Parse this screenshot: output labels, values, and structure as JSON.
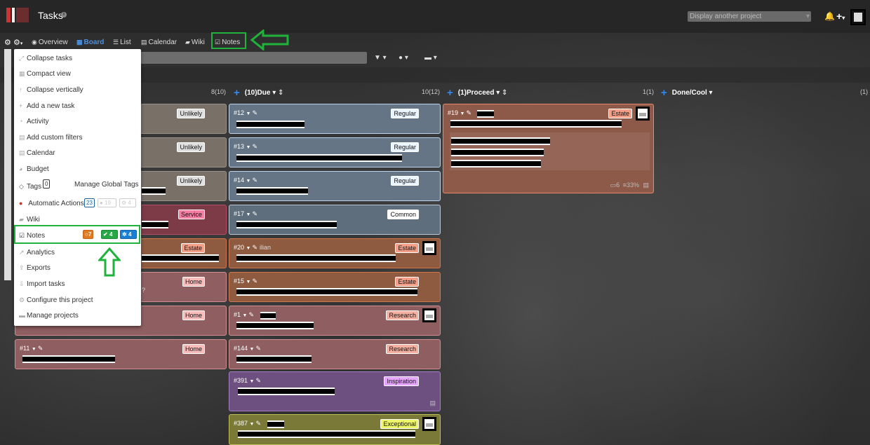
{
  "header": {
    "title": "Tasks",
    "info_icon": "info-icon",
    "project_select_placeholder": "Display another project",
    "bell_icon": "bell-icon",
    "plus_icon": "plus-icon"
  },
  "nav": {
    "settings_icon": "gear-icon",
    "items": [
      {
        "label": "Overview",
        "icon": "eye-icon"
      },
      {
        "label": "Board",
        "icon": "grid-icon",
        "active": true
      },
      {
        "label": "List",
        "icon": "list-icon"
      },
      {
        "label": "Calendar",
        "icon": "calendar-icon"
      },
      {
        "label": "Wiki",
        "icon": "book-icon"
      },
      {
        "label": "Notes",
        "icon": "checkbox-icon"
      }
    ]
  },
  "columns": [
    {
      "name": "(10)Due",
      "count": "8(10)"
    },
    {
      "name": "(1)Proceed",
      "count": "10(12)"
    },
    {
      "name": "Done/Cool",
      "count": "1(1)"
    },
    {
      "name": "",
      "count": "(1)"
    }
  ],
  "column1_cards": [
    {
      "tag": "Unlikely"
    },
    {
      "tag": "Unlikely"
    },
    {
      "tag": "Unlikely"
    },
    {
      "tag": "Service"
    },
    {
      "tag": "Estate"
    },
    {
      "tag": "Home"
    },
    {
      "tag": "Home"
    },
    {
      "id": "#11",
      "tag": "Home"
    }
  ],
  "column2_cards": [
    {
      "id": "#12",
      "tag": "Regular"
    },
    {
      "id": "#13",
      "tag": "Regular"
    },
    {
      "id": "#14",
      "tag": "Regular"
    },
    {
      "id": "#17",
      "tag": "Common"
    },
    {
      "id": "#20",
      "tag": "Estate",
      "assignee": "ilian"
    },
    {
      "id": "#15",
      "tag": "Estate"
    },
    {
      "id": "#1",
      "tag": "Research"
    },
    {
      "id": "#144",
      "tag": "Research"
    },
    {
      "id": "#391",
      "tag": "Inspiration"
    },
    {
      "id": "#387",
      "tag": "Exceptional"
    }
  ],
  "column3_cards": [
    {
      "id": "#19",
      "tag": "Estate",
      "footer_comments": "6",
      "footer_progress": "33%"
    }
  ],
  "menu": {
    "items": [
      {
        "label": "Collapse tasks",
        "icon": "collapse-icon"
      },
      {
        "label": "Compact view",
        "icon": "compact-icon"
      },
      {
        "label": "Collapse vertically",
        "icon": "arrow-up-icon"
      },
      {
        "label": "Add a new task",
        "icon": "plus-icon"
      },
      {
        "label": "Activity",
        "icon": "dashboard-icon"
      },
      {
        "label": "Add custom filters",
        "icon": "filter-icon"
      },
      {
        "label": "Calendar",
        "icon": "calendar-icon"
      },
      {
        "label": "Budget",
        "icon": "pie-chart-icon"
      },
      {
        "label": "Tags",
        "icon": "tag-icon",
        "count": "0",
        "extra": "Manage Global Tags"
      },
      {
        "label": "Automatic Actions",
        "icon": "robot-icon",
        "count": "23",
        "count2": "19",
        "count3": "4"
      },
      {
        "label": "Wiki",
        "icon": "book-icon"
      },
      {
        "label": "Notes",
        "icon": "checkbox-icon",
        "badge_open": "7",
        "badge_done": "4",
        "badge_progress": "4"
      },
      {
        "label": "Analytics",
        "icon": "line-chart-icon"
      },
      {
        "label": "Exports",
        "icon": "upload-icon"
      },
      {
        "label": "Import tasks",
        "icon": "download-icon"
      },
      {
        "label": "Configure this project",
        "icon": "cog-icon"
      },
      {
        "label": "Manage projects",
        "icon": "folder-icon"
      }
    ]
  },
  "partial_text": {
    "card6_fragment": "?"
  },
  "colors": {
    "accent": "#2e8cf0",
    "highlight": "#1fb33b",
    "badge_open": "#e07b1f",
    "badge_done": "#28a745",
    "badge_progress": "#1a7fd0"
  }
}
